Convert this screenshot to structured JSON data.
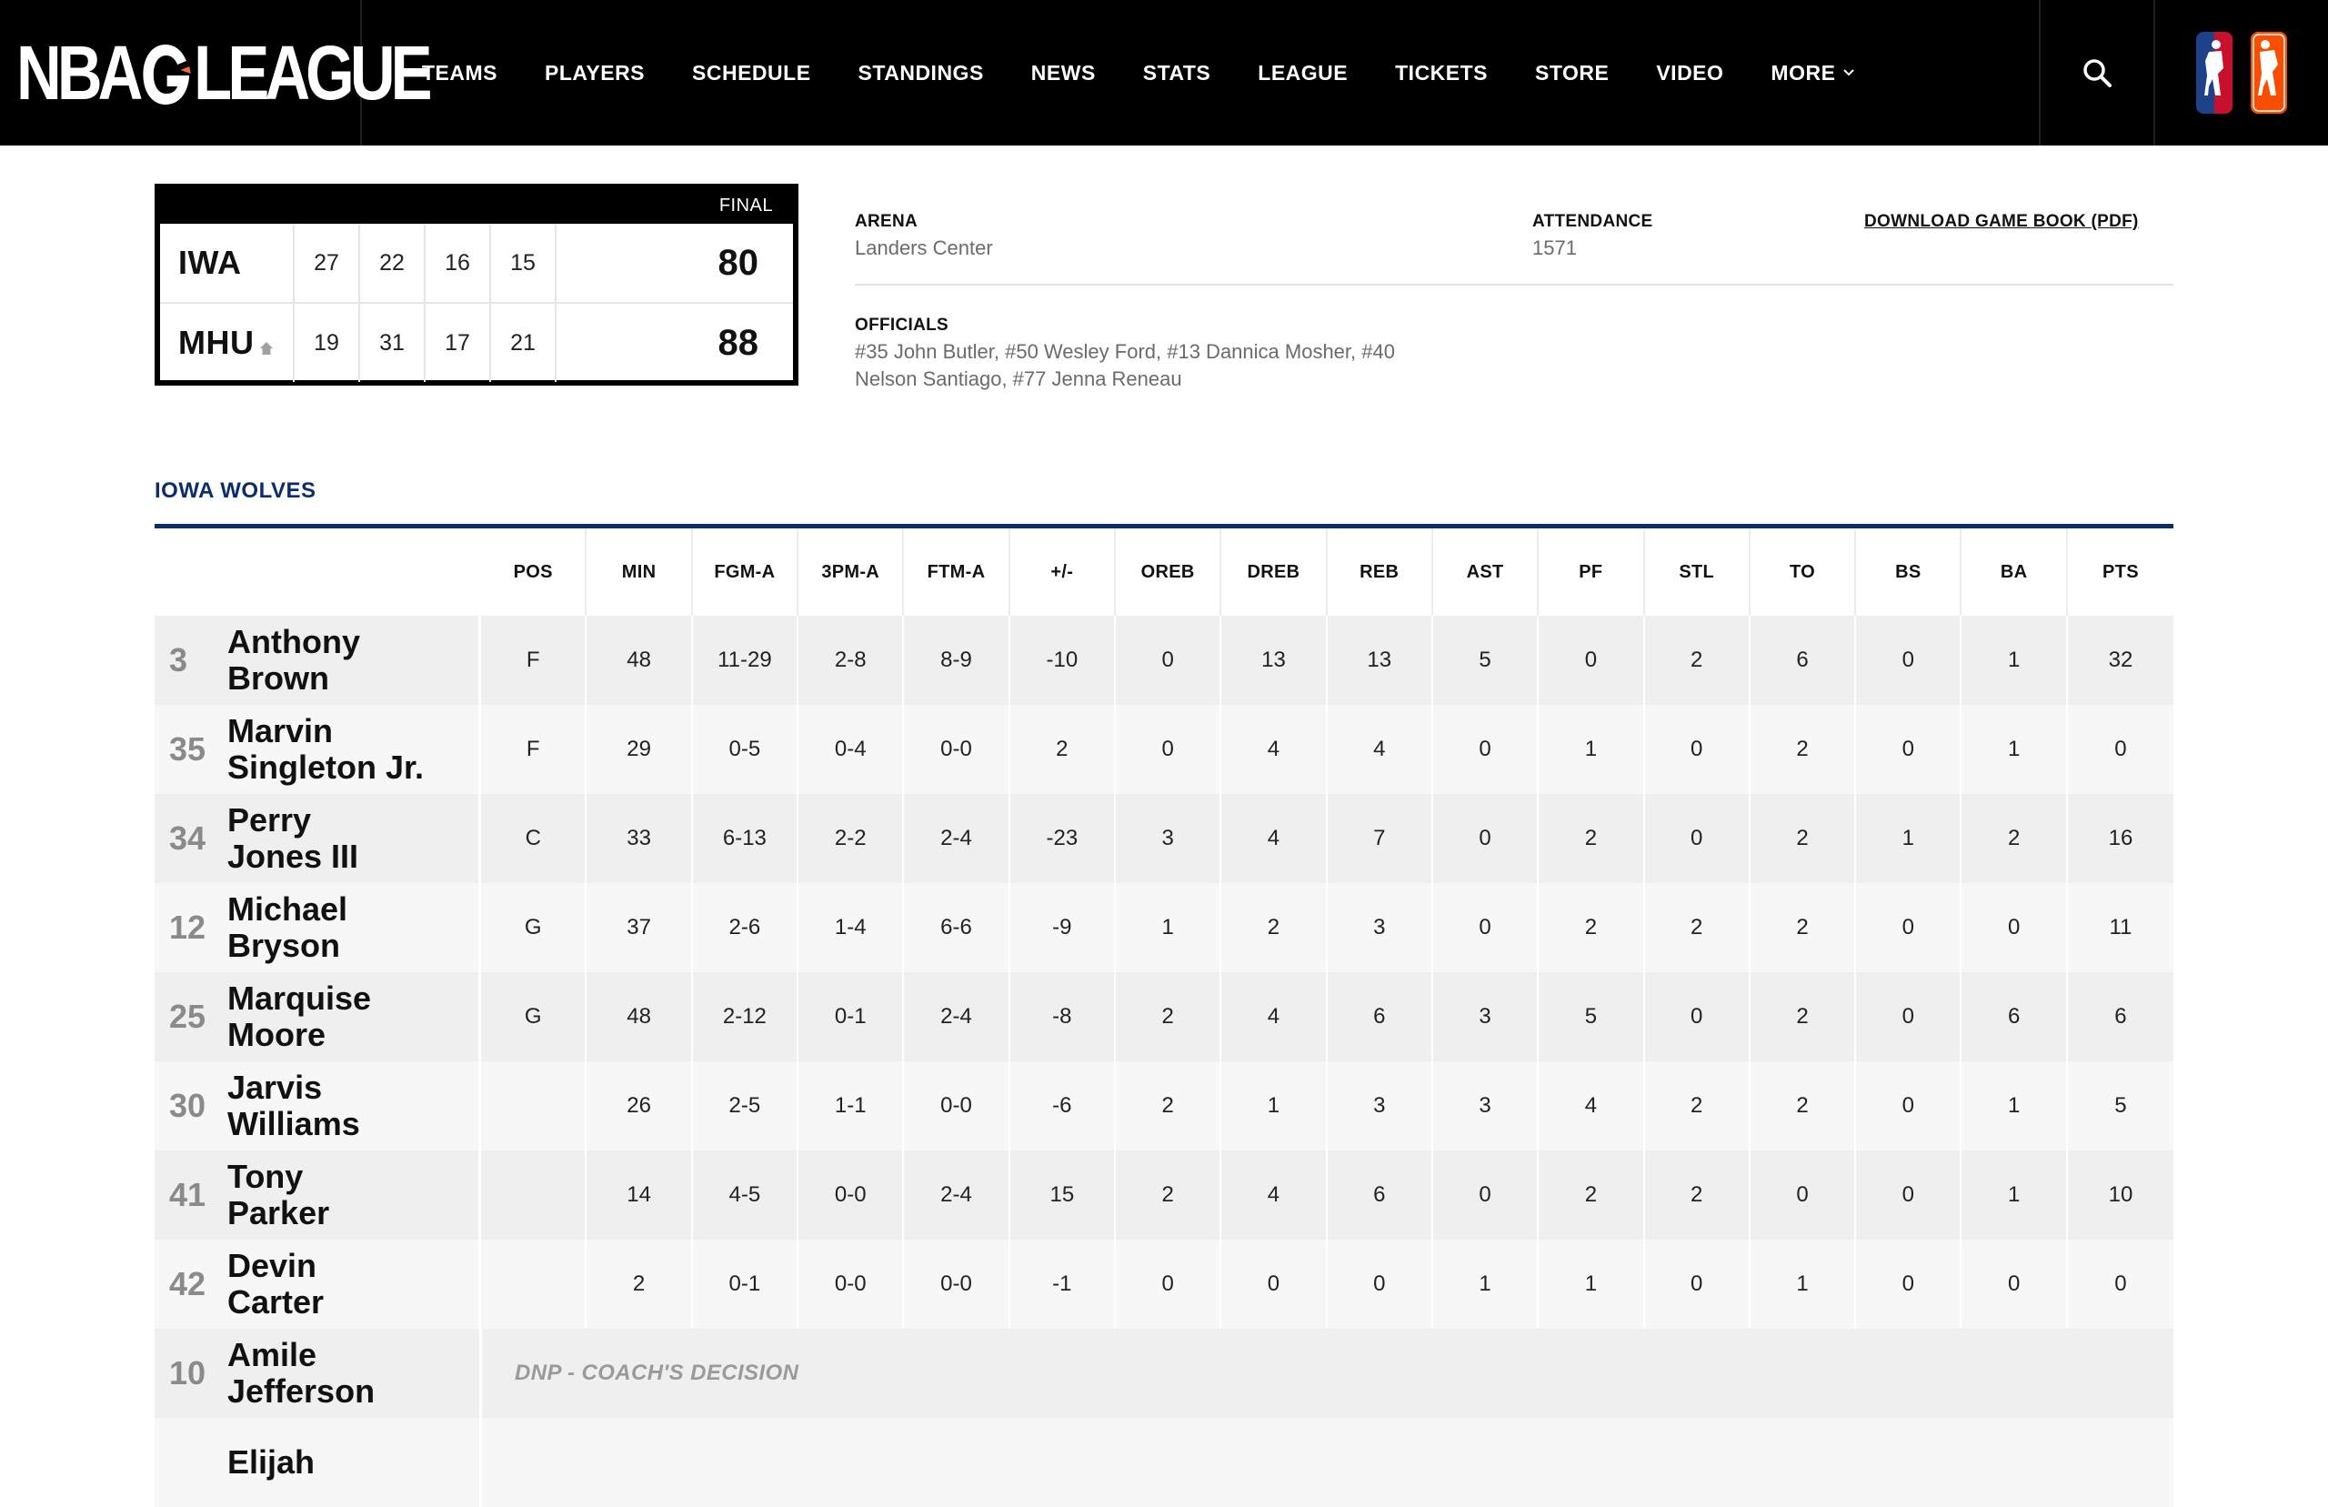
{
  "nav": {
    "logo_text_left": "NBA",
    "logo_text_right": "LEAGUE",
    "items": [
      {
        "label": "TEAMS"
      },
      {
        "label": "PLAYERS"
      },
      {
        "label": "SCHEDULE"
      },
      {
        "label": "STANDINGS"
      },
      {
        "label": "NEWS"
      },
      {
        "label": "STATS"
      },
      {
        "label": "LEAGUE"
      },
      {
        "label": "TICKETS"
      },
      {
        "label": "STORE"
      },
      {
        "label": "VIDEO"
      },
      {
        "label": "MORE"
      }
    ],
    "icons": [
      "search-icon",
      "nba-logo-icon",
      "wnba-logo-icon",
      "chevron-down-icon"
    ],
    "badge_colors": {
      "nba_blue": "#1d428a",
      "nba_red": "#c8102e",
      "wnba_orange": "#fa4d00"
    }
  },
  "scoreboard": {
    "status": "FINAL",
    "teams": [
      {
        "abbr": "IWA",
        "quarters": [
          "27",
          "22",
          "16",
          "15"
        ],
        "total": "80",
        "home": false
      },
      {
        "abbr": "MHU",
        "quarters": [
          "19",
          "31",
          "17",
          "21"
        ],
        "total": "88",
        "home": true
      }
    ]
  },
  "game_info": {
    "arena_label": "ARENA",
    "arena": "Landers Center",
    "attendance_label": "ATTENDANCE",
    "attendance": "1571",
    "download_label": "DOWNLOAD GAME BOOK (PDF)",
    "officials_label": "OFFICIALS",
    "officials_line1": "#35 John Butler, #50 Wesley Ford, #13 Dannica Mosher, #40",
    "officials_line2": "Nelson Santiago, #77 Jenna Reneau"
  },
  "team": {
    "name": "IOWA WOLVES",
    "accent_color": "#0b2d6b"
  },
  "boxscore": {
    "columns": [
      "POS",
      "MIN",
      "FGM-A",
      "3PM-A",
      "FTM-A",
      "+/-",
      "OREB",
      "DREB",
      "REB",
      "AST",
      "PF",
      "STL",
      "TO",
      "BS",
      "BA",
      "PTS"
    ],
    "players": [
      {
        "num": "3",
        "first": "Anthony",
        "last": "Brown",
        "stats": [
          "F",
          "48",
          "11-29",
          "2-8",
          "8-9",
          "-10",
          "0",
          "13",
          "13",
          "5",
          "0",
          "2",
          "6",
          "0",
          "1",
          "32"
        ]
      },
      {
        "num": "35",
        "first": "Marvin",
        "last": "Singleton Jr.",
        "stats": [
          "F",
          "29",
          "0-5",
          "0-4",
          "0-0",
          "2",
          "0",
          "4",
          "4",
          "0",
          "1",
          "0",
          "2",
          "0",
          "1",
          "0"
        ]
      },
      {
        "num": "34",
        "first": "Perry",
        "last": "Jones III",
        "stats": [
          "C",
          "33",
          "6-13",
          "2-2",
          "2-4",
          "-23",
          "3",
          "4",
          "7",
          "0",
          "2",
          "0",
          "2",
          "1",
          "2",
          "16"
        ]
      },
      {
        "num": "12",
        "first": "Michael",
        "last": "Bryson",
        "stats": [
          "G",
          "37",
          "2-6",
          "1-4",
          "6-6",
          "-9",
          "1",
          "2",
          "3",
          "0",
          "2",
          "2",
          "2",
          "0",
          "0",
          "11"
        ]
      },
      {
        "num": "25",
        "first": "Marquise",
        "last": "Moore",
        "stats": [
          "G",
          "48",
          "2-12",
          "0-1",
          "2-4",
          "-8",
          "2",
          "4",
          "6",
          "3",
          "5",
          "0",
          "2",
          "0",
          "6",
          "6"
        ]
      },
      {
        "num": "30",
        "first": "Jarvis",
        "last": "Williams",
        "stats": [
          "",
          "26",
          "2-5",
          "1-1",
          "0-0",
          "-6",
          "2",
          "1",
          "3",
          "3",
          "4",
          "2",
          "2",
          "0",
          "1",
          "5"
        ]
      },
      {
        "num": "41",
        "first": "Tony",
        "last": "Parker",
        "stats": [
          "",
          "14",
          "4-5",
          "0-0",
          "2-4",
          "15",
          "2",
          "4",
          "6",
          "0",
          "2",
          "2",
          "0",
          "0",
          "1",
          "10"
        ]
      },
      {
        "num": "42",
        "first": "Devin",
        "last": "Carter",
        "stats": [
          "",
          "2",
          "0-1",
          "0-0",
          "0-0",
          "-1",
          "0",
          "0",
          "0",
          "1",
          "1",
          "0",
          "1",
          "0",
          "0",
          "0"
        ]
      },
      {
        "num": "10",
        "first": "Amile",
        "last": "Jefferson",
        "dnp": "DNP - COACH'S DECISION"
      },
      {
        "num": "",
        "first": "Elijah",
        "last": "",
        "dnp": ""
      }
    ]
  }
}
